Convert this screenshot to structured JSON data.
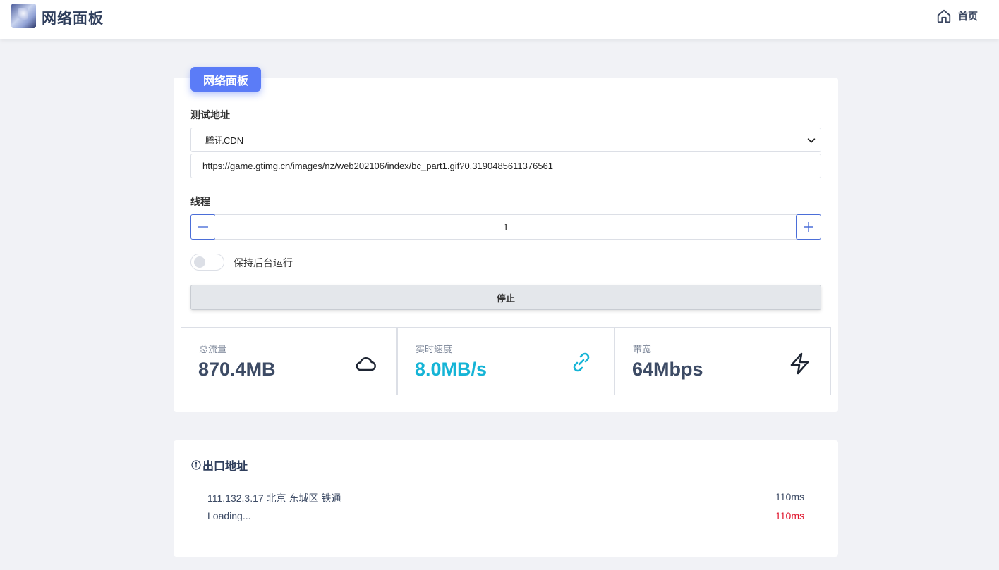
{
  "header": {
    "app_title": "网络面板",
    "home_label": "首页",
    "logo_icon": "anime-avatar-logo",
    "home_icon": "home-icon"
  },
  "panel": {
    "badge": "网络面板",
    "test_address_label": "测试地址",
    "selected_source": "腾讯CDN",
    "url_value": "https://game.gtimg.cn/images/nz/web202106/index/bc_part1.gif?0.3190485611376561",
    "threads_label": "线程",
    "threads_value": "1",
    "keep_background_label": "保持后台运行",
    "keep_background_on": false,
    "stop_label": "停止",
    "accent_color": "#5b7cf7"
  },
  "stats": [
    {
      "title": "总流量",
      "value": "870.4MB",
      "icon": "cloud-icon",
      "color": "#3d4b65"
    },
    {
      "title": "实时速度",
      "value": "8.0MB/s",
      "icon": "link-icon",
      "color": "#15b4d6"
    },
    {
      "title": "带宽",
      "value": "64Mbps",
      "icon": "lightning-icon",
      "color": "#3d4b65"
    }
  ],
  "exit": {
    "title": "出口地址",
    "title_icon": "info-icon",
    "rows": [
      {
        "address": "111.132.3.17 北京 东城区 铁通",
        "latency": "110ms",
        "latency_color": "#3d4b65"
      },
      {
        "address": "Loading...",
        "latency": "110ms",
        "latency_color": "#e0142c"
      }
    ]
  }
}
